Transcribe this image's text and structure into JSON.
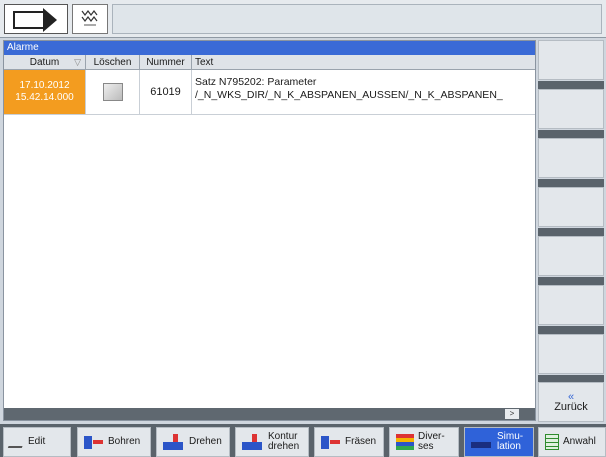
{
  "alarm_panel": {
    "title": "Alarme",
    "columns": {
      "datum": "Datum",
      "loeschen": "Löschen",
      "nummer": "Nummer",
      "text": "Text"
    },
    "rows": [
      {
        "date": "17.10.2012",
        "time": "15.42.14.000",
        "number": "61019",
        "text_line1": "Satz N795202: Parameter",
        "text_line2": "/_N_WKS_DIR/_N_K_ABSPANEN_AUSSEN/_N_K_ABSPANEN_"
      }
    ],
    "scroll_right_label": ">"
  },
  "vertical_softkeys": {
    "back_chevron": "«",
    "back_label": "Zurück"
  },
  "bottom_softkeys": {
    "edit": "Edit",
    "bohren": "Bohren",
    "drehen": "Drehen",
    "kontur_line1": "Kontur",
    "kontur_line2": "drehen",
    "fraesen": "Fräsen",
    "diverses_line1": "Diver-",
    "diverses_line2": "ses",
    "simulation_line1": "Simu-",
    "simulation_line2": "lation",
    "anwahl": "Anwahl"
  },
  "colors": {
    "title_bar": "#3a6ad6",
    "alarm_highlight": "#f39c1f",
    "active_softkey": "#2f62d9"
  }
}
